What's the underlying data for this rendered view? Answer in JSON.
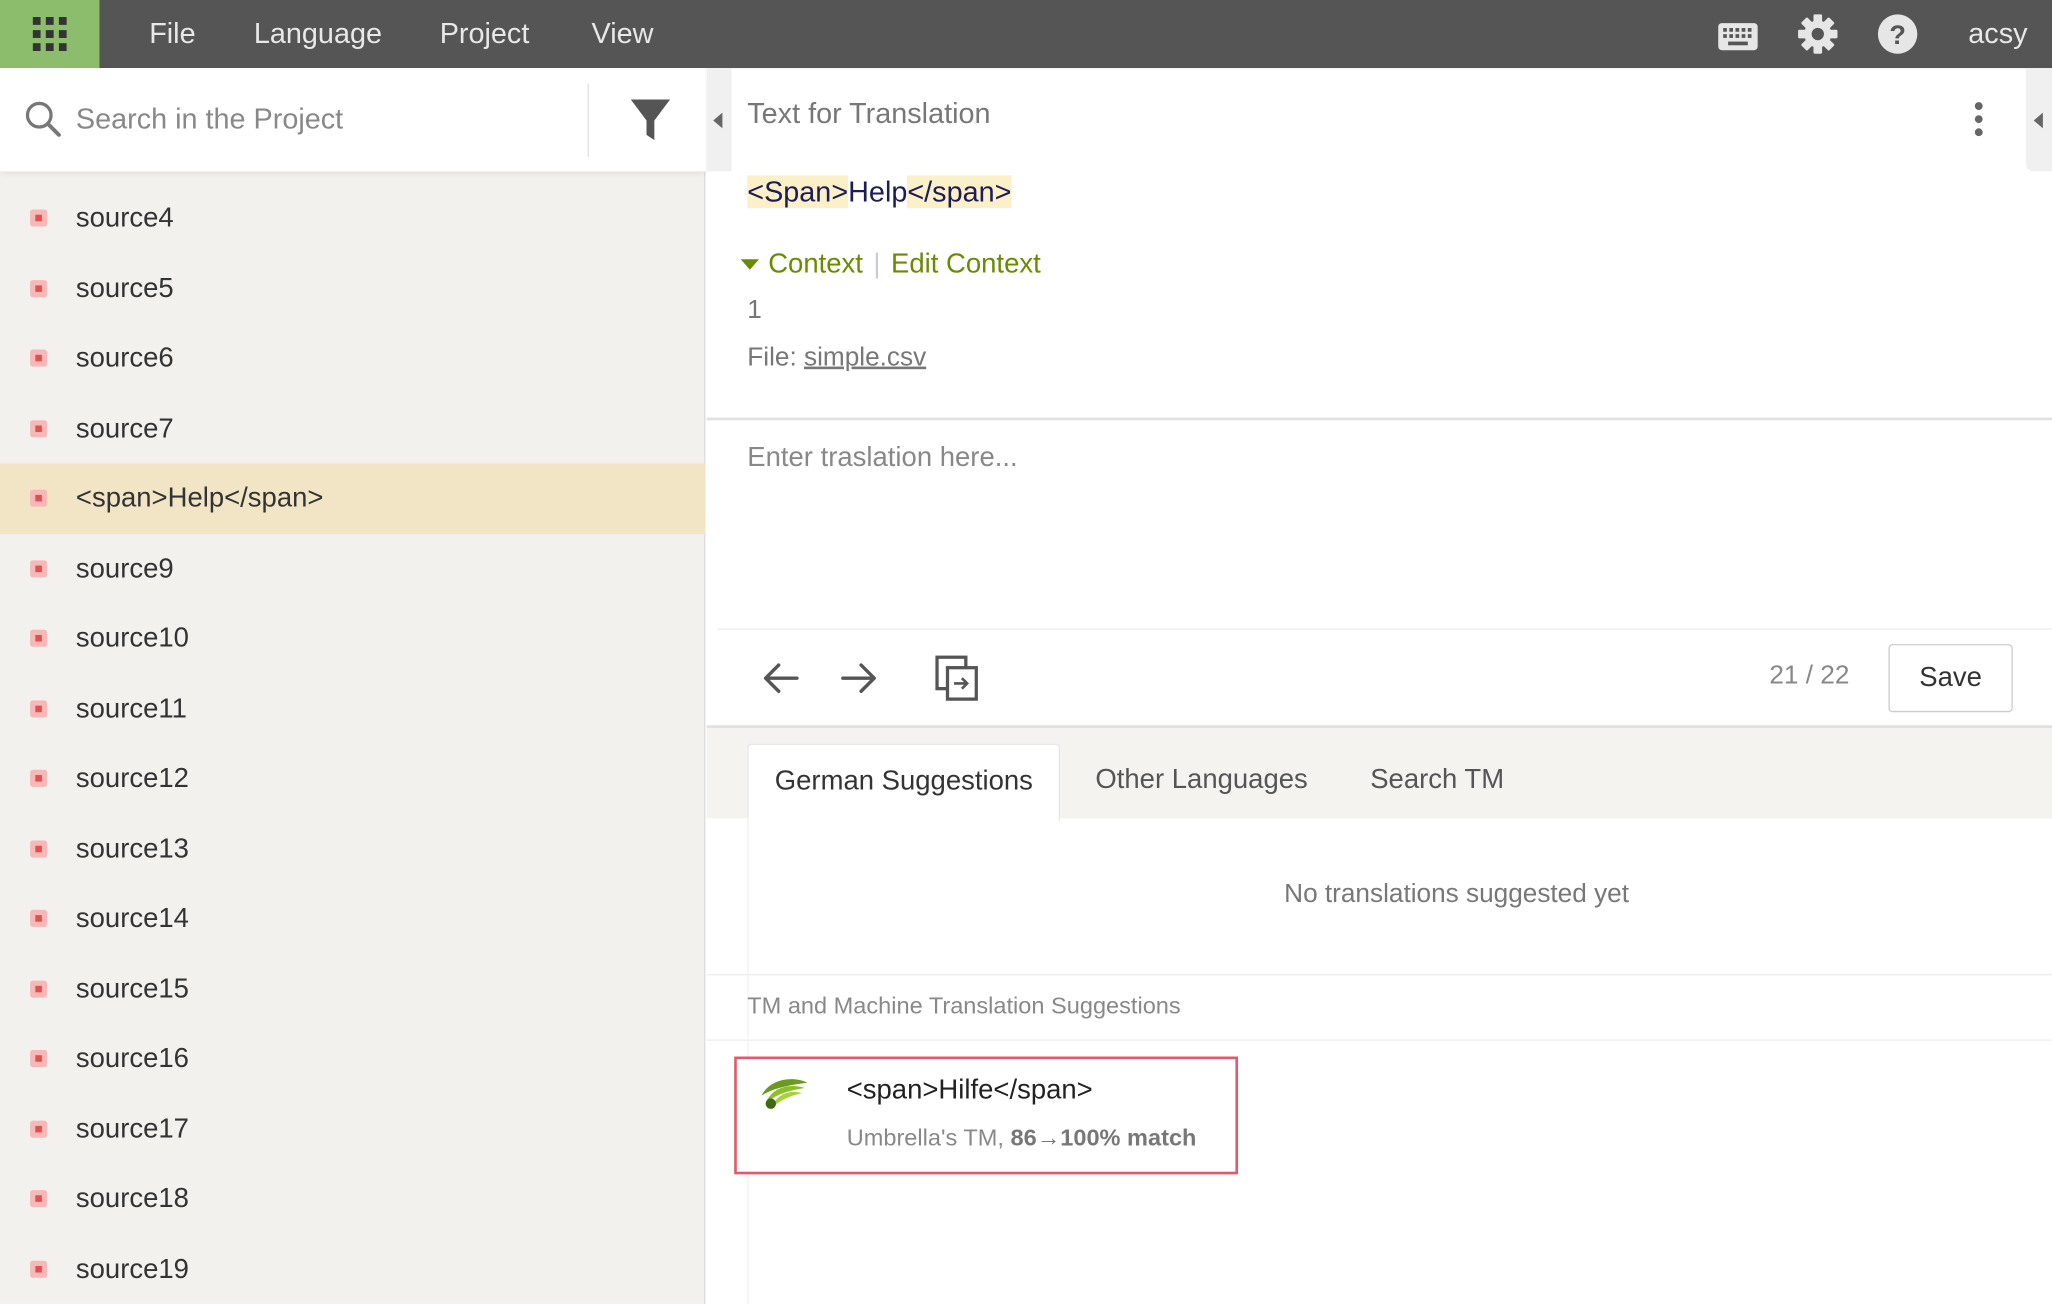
{
  "menu": {
    "items": [
      "File",
      "Language",
      "Project",
      "View"
    ],
    "user": "acsy"
  },
  "search": {
    "placeholder": "Search in the Project"
  },
  "strings": [
    {
      "label": "source4",
      "selected": false
    },
    {
      "label": "source5",
      "selected": false
    },
    {
      "label": "source6",
      "selected": false
    },
    {
      "label": "source7",
      "selected": false
    },
    {
      "label": "<span>Help</span>",
      "selected": true
    },
    {
      "label": "source9",
      "selected": false
    },
    {
      "label": "source10",
      "selected": false
    },
    {
      "label": "source11",
      "selected": false
    },
    {
      "label": "source12",
      "selected": false
    },
    {
      "label": "source13",
      "selected": false
    },
    {
      "label": "source14",
      "selected": false
    },
    {
      "label": "source15",
      "selected": false
    },
    {
      "label": "source16",
      "selected": false
    },
    {
      "label": "source17",
      "selected": false
    },
    {
      "label": "source18",
      "selected": false
    },
    {
      "label": "source19",
      "selected": false
    }
  ],
  "editor": {
    "section_title": "Text for Translation",
    "source": {
      "tag_open": "<Span>",
      "text": "Help",
      "tag_close": "</span>"
    },
    "context_label": "Context",
    "edit_context_label": "Edit Context",
    "context_value": "1",
    "file_prefix": "File:",
    "file_name": "simple.csv",
    "translation_placeholder": "Enter traslation here...",
    "counter": "21 / 22",
    "save_label": "Save"
  },
  "tabs": {
    "items": [
      "German Suggestions",
      "Other Languages",
      "Search TM"
    ],
    "active": 0
  },
  "suggestions": {
    "empty_text": "No translations suggested yet",
    "tm_header": "TM and Machine Translation Suggestions",
    "tm_result": {
      "text": "<span>Hilfe</span>",
      "source": "Umbrella's TM,",
      "match": "86→100% match"
    }
  },
  "colors": {
    "topbar": "#555555",
    "apps_button": "#8cbd6d",
    "selected_row": "#f1e5c6",
    "context_link": "#6a8a00",
    "tm_card_border": "#e15a6b"
  },
  "icons": [
    "apps-grid-icon",
    "keyboard-icon",
    "gear-icon",
    "help-icon",
    "search-icon",
    "filter-icon",
    "kebab-menu-icon",
    "arrow-left-icon",
    "arrow-right-icon",
    "copy-source-icon",
    "tm-logo-icon"
  ]
}
